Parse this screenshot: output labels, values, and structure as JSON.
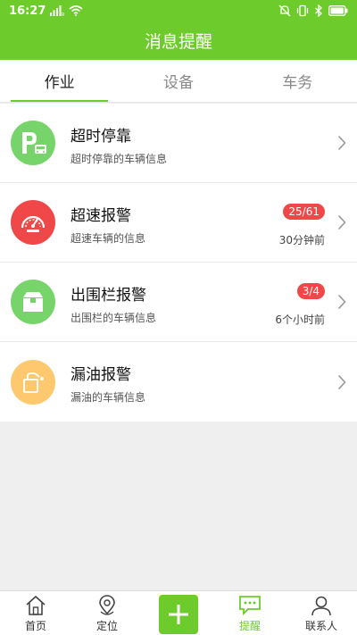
{
  "status_bar": {
    "time": "16:27"
  },
  "header": {
    "title": "消息提醒"
  },
  "tabs": [
    {
      "label": "作业",
      "active": true
    },
    {
      "label": "设备",
      "active": false
    },
    {
      "label": "车务",
      "active": false
    }
  ],
  "items": [
    {
      "title": "超时停靠",
      "subtitle": "超时停靠的车辆信息",
      "badge": "",
      "time": "",
      "icon": "parking-bus-icon",
      "color": "#77d46a"
    },
    {
      "title": "超速报警",
      "subtitle": "超速车辆的信息",
      "badge": "25/61",
      "time": "30分钟前",
      "icon": "speedometer-icon",
      "color": "#f04848"
    },
    {
      "title": "出围栏报警",
      "subtitle": "出围栏的车辆信息",
      "badge": "3/4",
      "time": "6个小时前",
      "icon": "box-icon",
      "color": "#77d46a"
    },
    {
      "title": "漏油报警",
      "subtitle": "漏油的车辆信息",
      "badge": "",
      "time": "",
      "icon": "oil-can-icon",
      "color": "#fdc86e"
    }
  ],
  "bottom_nav": {
    "home": "首页",
    "locate": "定位",
    "remind": "提醒",
    "contacts": "联系人"
  },
  "colors": {
    "brand": "#6dcc2b",
    "alert": "#f04848"
  }
}
